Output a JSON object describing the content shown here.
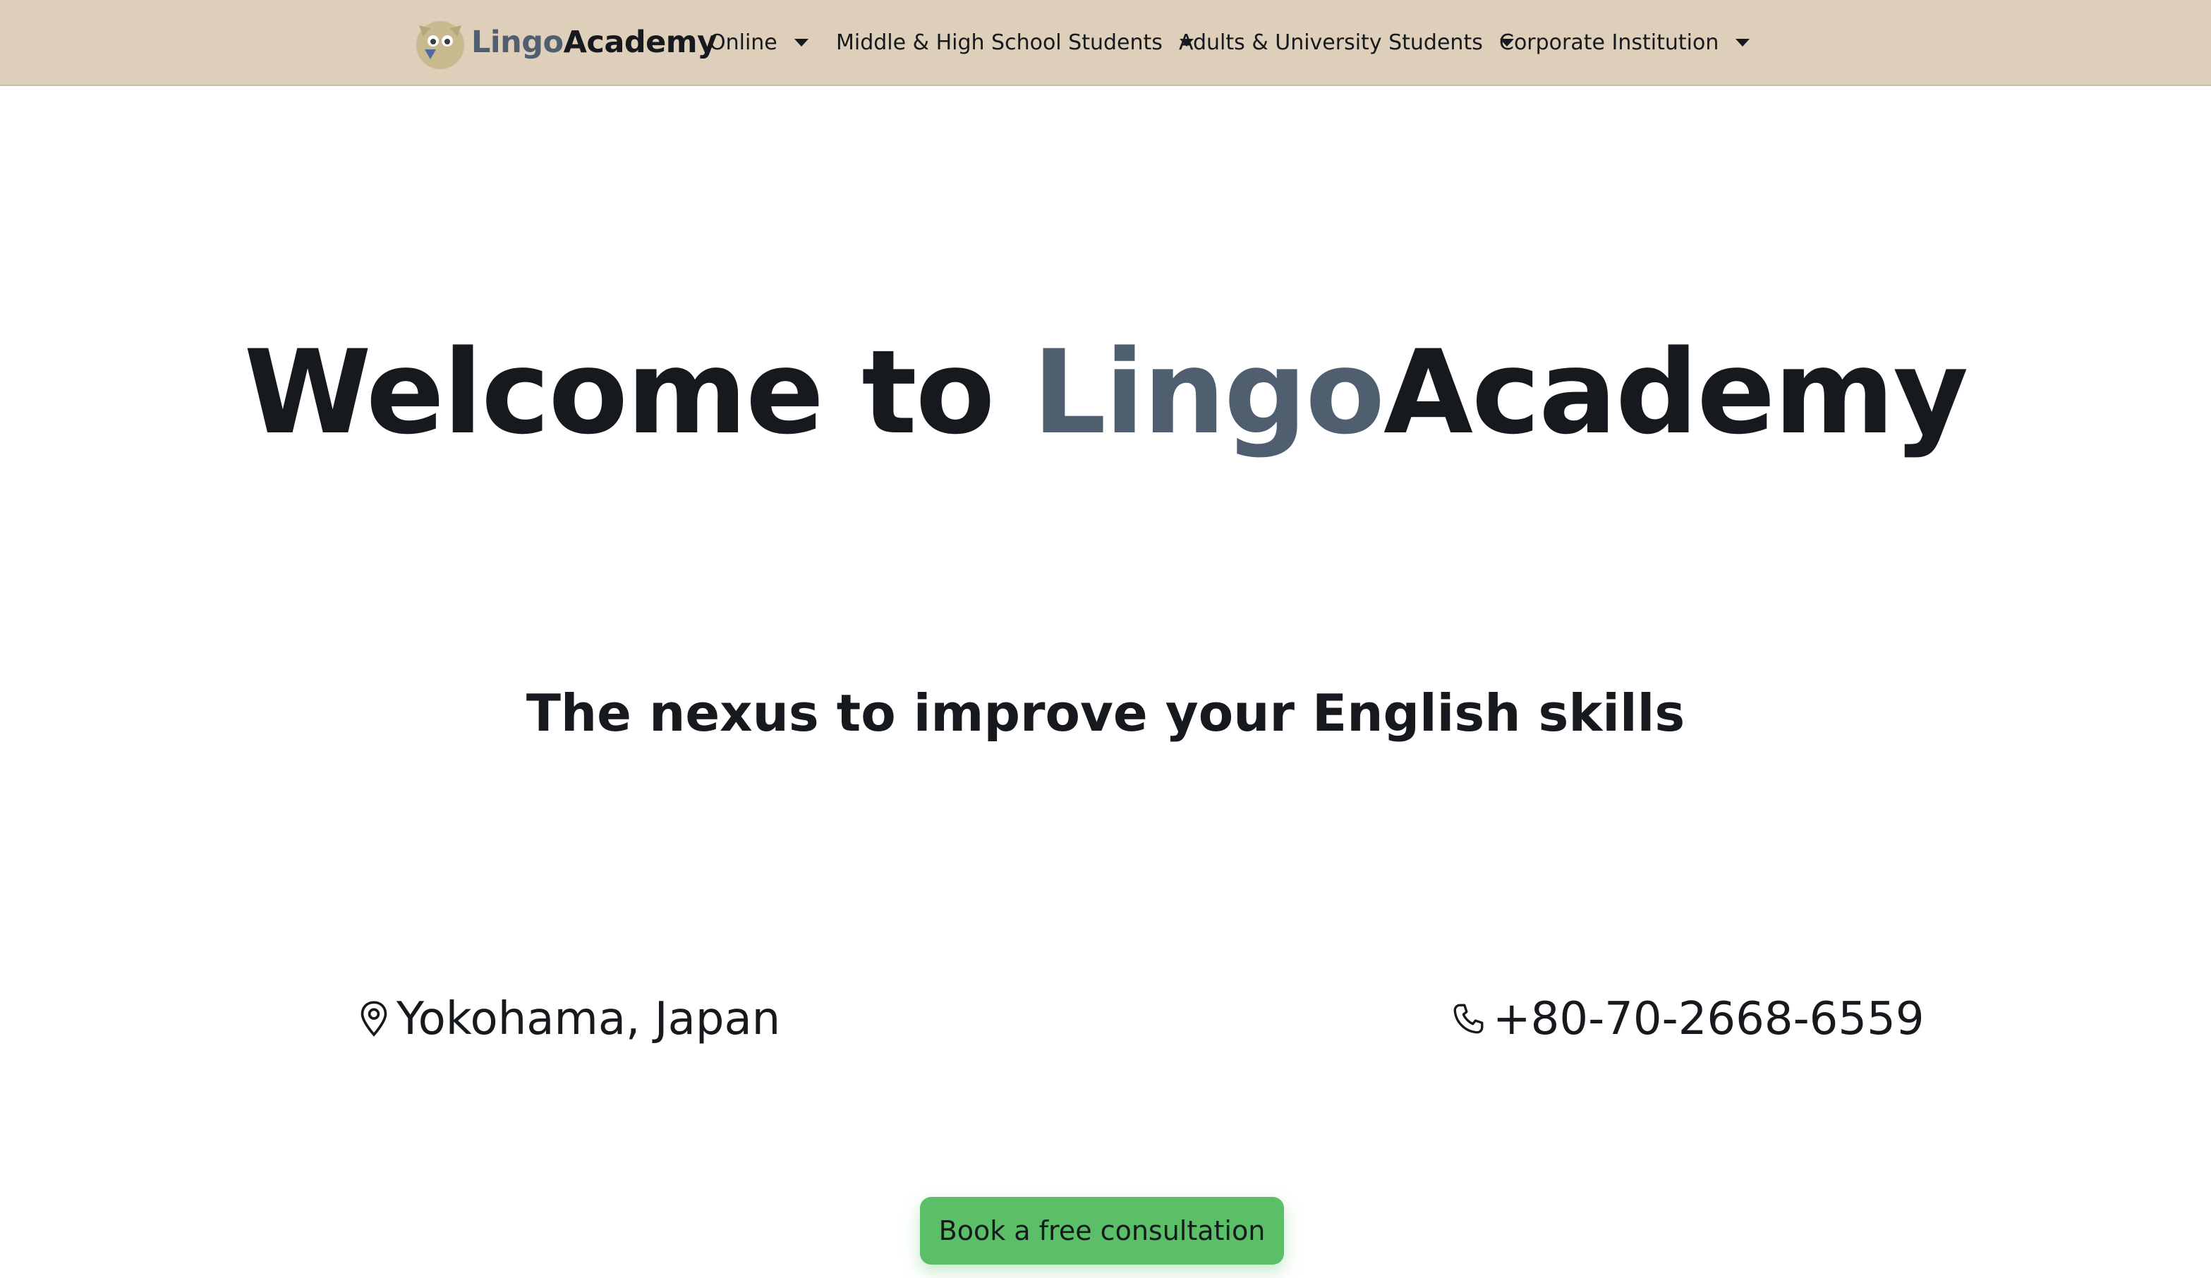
{
  "brand": {
    "part1": "Lingo",
    "part2": "Academy",
    "logo_icon": "owl-logo-icon",
    "colors": {
      "highlight": "#505f70",
      "text": "#16191d"
    }
  },
  "nav": {
    "background": "#ddcfb9",
    "items": [
      {
        "label": "Online",
        "icon": "caret-down-icon"
      },
      {
        "label": "Middle & High School Students",
        "icon": "caret-down-icon"
      },
      {
        "label": "Adults & University Students",
        "icon": "caret-down-icon"
      },
      {
        "label": "Corporate Institution",
        "icon": "caret-down-icon"
      }
    ]
  },
  "hero": {
    "title_prefix": "Welcome to ",
    "title_highlight": "Lingo",
    "title_suffix": "Academy",
    "tagline": "The nexus to improve your English skills"
  },
  "contact": {
    "location": {
      "icon": "map-pin-icon",
      "text": "Yokohama, Japan"
    },
    "phone": {
      "icon": "phone-icon",
      "text": "+80-70-2668-6559"
    }
  },
  "cta": {
    "label": "Book a free consultation",
    "color": "#5bbf67"
  }
}
